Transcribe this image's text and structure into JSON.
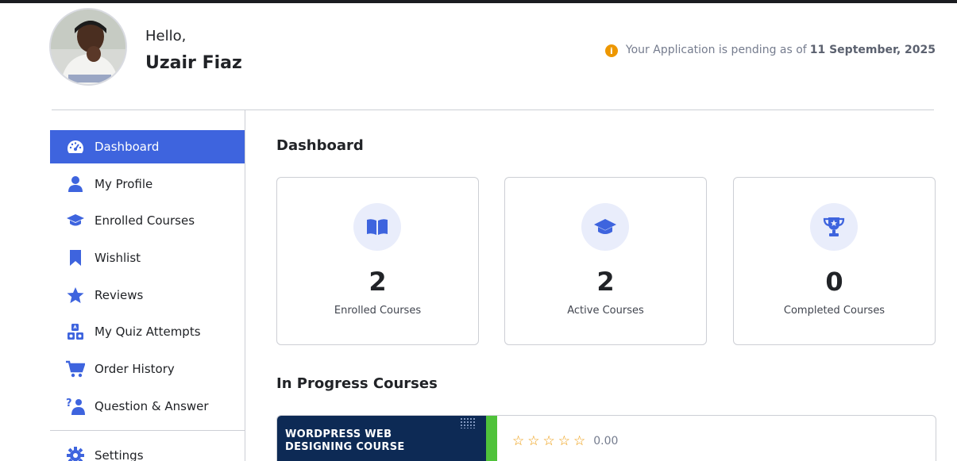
{
  "header": {
    "greeting": "Hello,",
    "username": "Uzair Fiaz",
    "notice_text": "Your Application is pending as of",
    "notice_date": "11 September, 2025",
    "notice_icon": "info-icon"
  },
  "sidebar": {
    "items": [
      {
        "label": "Dashboard",
        "icon": "dashboard-gauge-icon"
      },
      {
        "label": "My Profile",
        "icon": "user-icon"
      },
      {
        "label": "Enrolled Courses",
        "icon": "graduation-cap-icon"
      },
      {
        "label": "Wishlist",
        "icon": "bookmark-icon"
      },
      {
        "label": "Reviews",
        "icon": "star-icon"
      },
      {
        "label": "My Quiz Attempts",
        "icon": "quiz-blocks-icon"
      },
      {
        "label": "Order History",
        "icon": "cart-icon"
      },
      {
        "label": "Question & Answer",
        "icon": "question-answer-icon"
      }
    ],
    "settings_label": "Settings",
    "active_index": 0
  },
  "main": {
    "title": "Dashboard",
    "stats": [
      {
        "value": "2",
        "label": "Enrolled Courses",
        "icon": "open-book-icon"
      },
      {
        "value": "2",
        "label": "Active Courses",
        "icon": "graduation-cap-icon"
      },
      {
        "value": "0",
        "label": "Completed Courses",
        "icon": "trophy-icon"
      }
    ],
    "in_progress_title": "In Progress Courses",
    "course": {
      "thumb_line1": "WORDPRESS WEB",
      "thumb_line2": "DESIGNING COURSE",
      "rating": "0.00",
      "stars_filled": 0,
      "stars_total": 5
    }
  },
  "colors": {
    "accent": "#3e64de",
    "warning": "#ed9700",
    "text": "#212327",
    "muted": "#757c8e",
    "border": "#cdcfd5"
  }
}
